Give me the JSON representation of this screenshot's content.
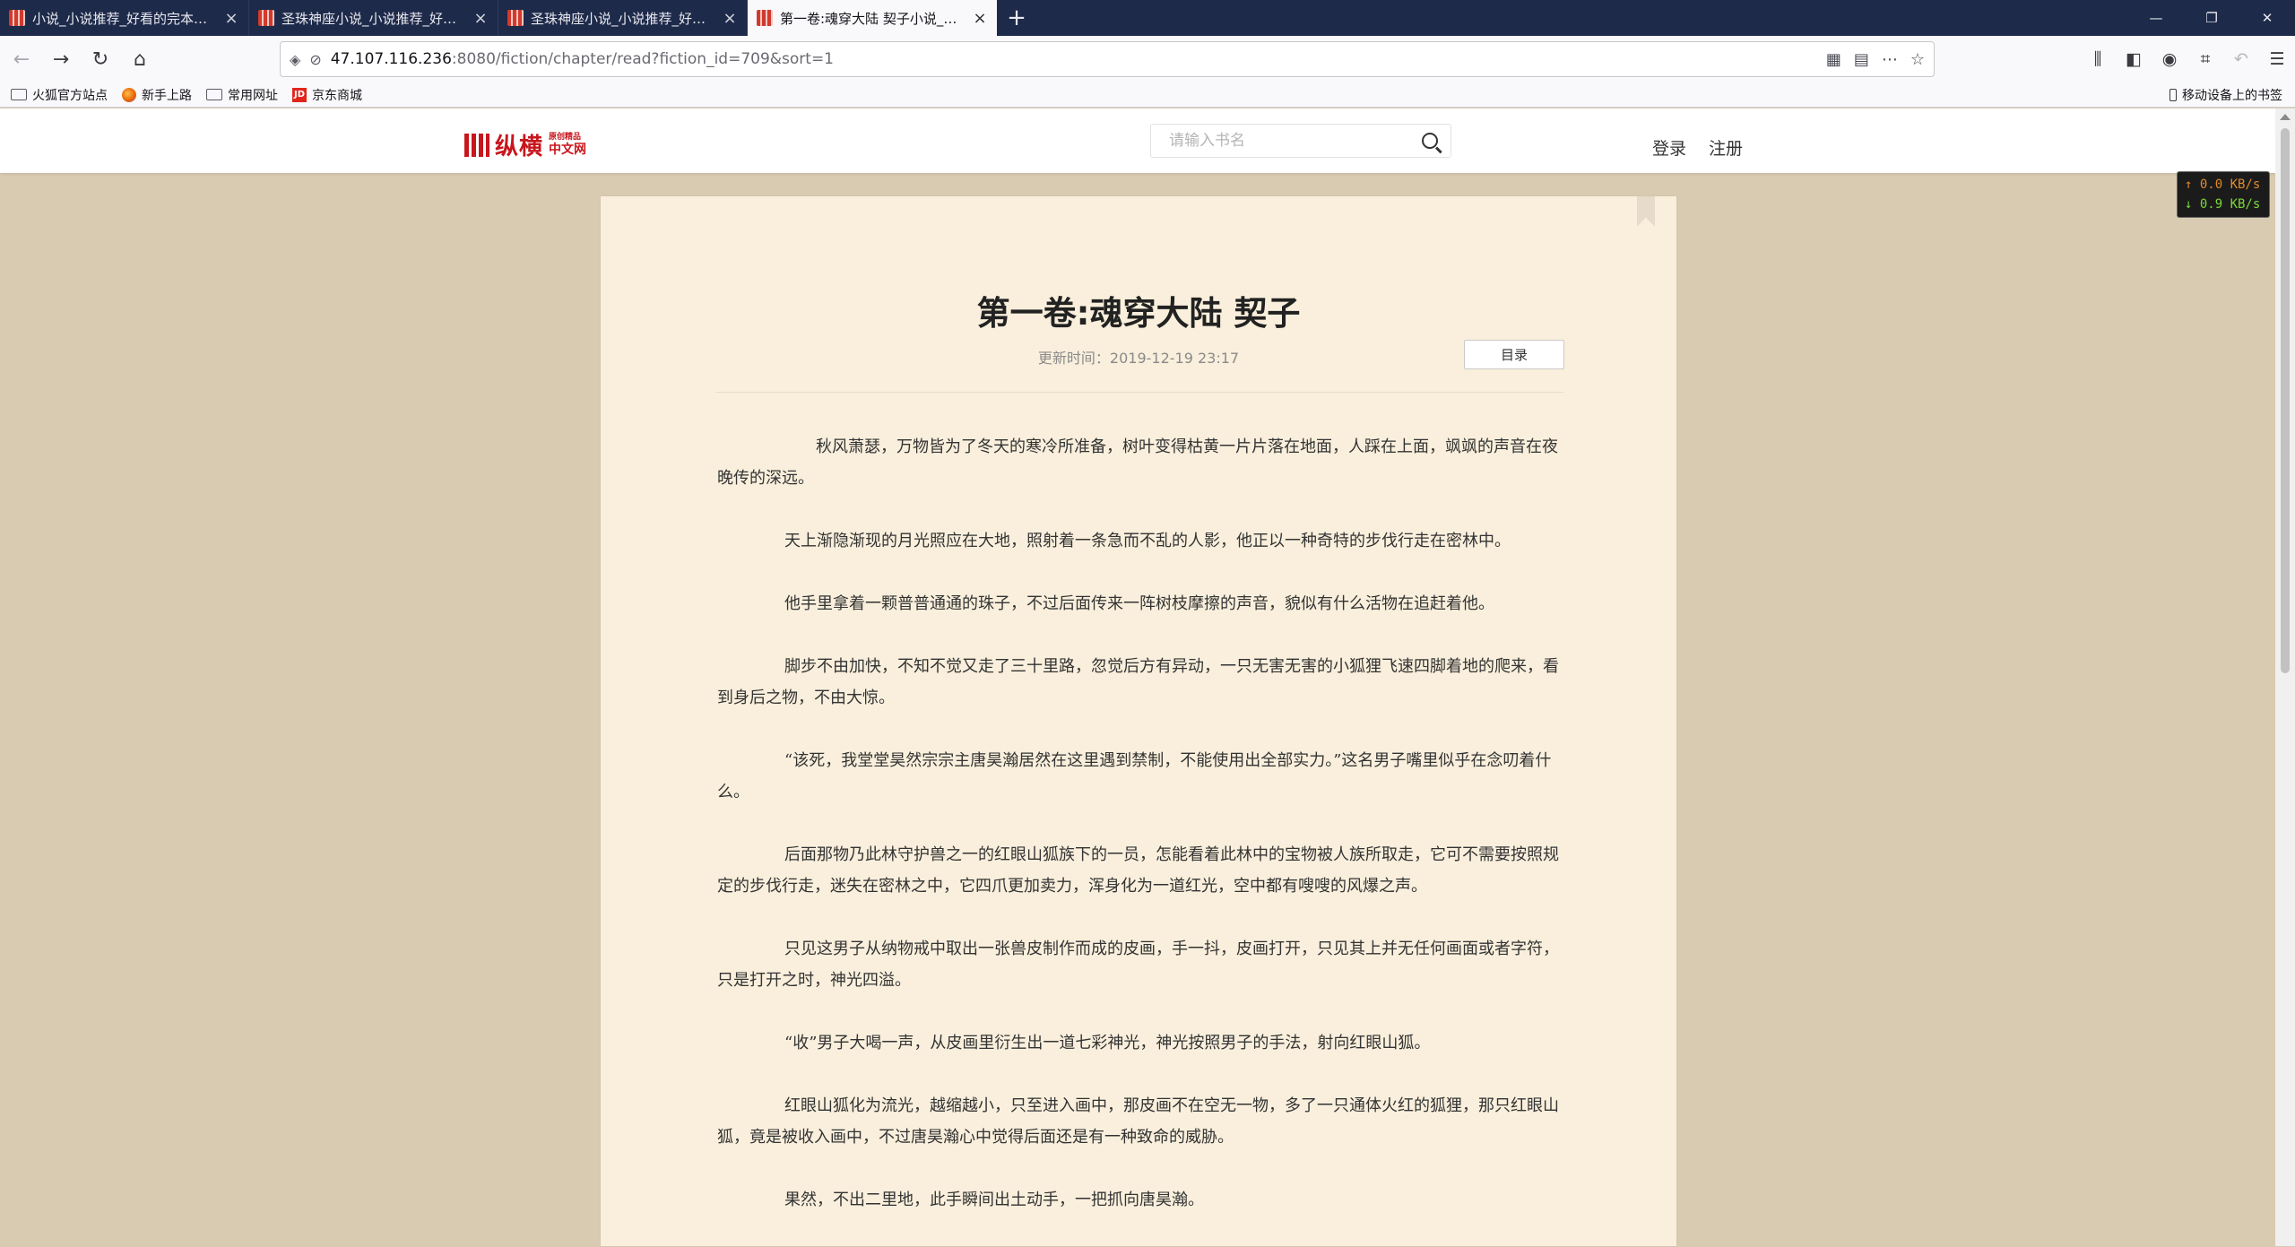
{
  "tabs": [
    {
      "title": "小说_小说推荐_好看的完本免费",
      "active": false
    },
    {
      "title": "圣珠神座小说_小说推荐_好看的",
      "active": false
    },
    {
      "title": "圣珠神座小说_小说推荐_好看的",
      "active": false
    },
    {
      "title": "第一卷:魂穿大陆 契子小说_小说",
      "active": true
    }
  ],
  "url": {
    "host": "47.107.116.236",
    "rest": ":8080/fiction/chapter/read?fiction_id=709&sort=1"
  },
  "bookmarks": [
    "火狐官方站点",
    "新手上路",
    "常用网址",
    "京东商城"
  ],
  "mobile_bookmarks": "移动设备上的书签",
  "site": {
    "logo_text": "纵横",
    "logo_sub_top": "原创精品",
    "logo_sub_bottom": "中文网",
    "search_placeholder": "请输入书名",
    "login": "登录",
    "register": "注册"
  },
  "chapter": {
    "title": "第一卷:魂穿大陆 契子",
    "update_time": "更新时间：2019-12-19 23:17",
    "toc_label": "目录",
    "paragraphs": [
      "秋风萧瑟，万物皆为了冬天的寒冷所准备，树叶变得枯黄一片片落在地面，人踩在上面，飒飒的声音在夜晚传的深远。",
      "天上渐隐渐现的月光照应在大地，照射着一条急而不乱的人影，他正以一种奇特的步伐行走在密林中。",
      "他手里拿着一颗普普通通的珠子，不过后面传来一阵树枝摩擦的声音，貌似有什么活物在追赶着他。",
      "脚步不由加快，不知不觉又走了三十里路，忽觉后方有异动，一只无害无害的小狐狸飞速四脚着地的爬来，看到身后之物，不由大惊。",
      "“该死，我堂堂昊然宗宗主唐昊瀚居然在这里遇到禁制，不能使用出全部实力。”这名男子嘴里似乎在念叨着什么。",
      "后面那物乃此林守护兽之一的红眼山狐族下的一员，怎能看着此林中的宝物被人族所取走，它可不需要按照规定的步伐行走，迷失在密林之中，它四爪更加卖力，浑身化为一道红光，空中都有嗖嗖的风爆之声。",
      "只见这男子从纳物戒中取出一张兽皮制作而成的皮画，手一抖，皮画打开，只见其上并无任何画面或者字符，只是打开之时，神光四溢。",
      "“收”男子大喝一声，从皮画里衍生出一道七彩神光，神光按照男子的手法，射向红眼山狐。",
      "红眼山狐化为流光，越缩越小，只至进入画中，那皮画不在空无一物，多了一只通体火红的狐狸，那只红眼山狐，竟是被收入画中，不过唐昊瀚心中觉得后面还是有一种致命的威胁。",
      "果然，不出二里地，此手瞬间出土动手，一把抓向唐昊瀚。"
    ]
  },
  "speed": {
    "up": "↑ 0.0 KB/s",
    "down": "↓ 0.9 KB/s"
  },
  "colors": {
    "page_bg": "#d9cbb1",
    "paper": "#f9efdc",
    "brand": "#c8161d",
    "tabbar": "#1e2a4a"
  }
}
